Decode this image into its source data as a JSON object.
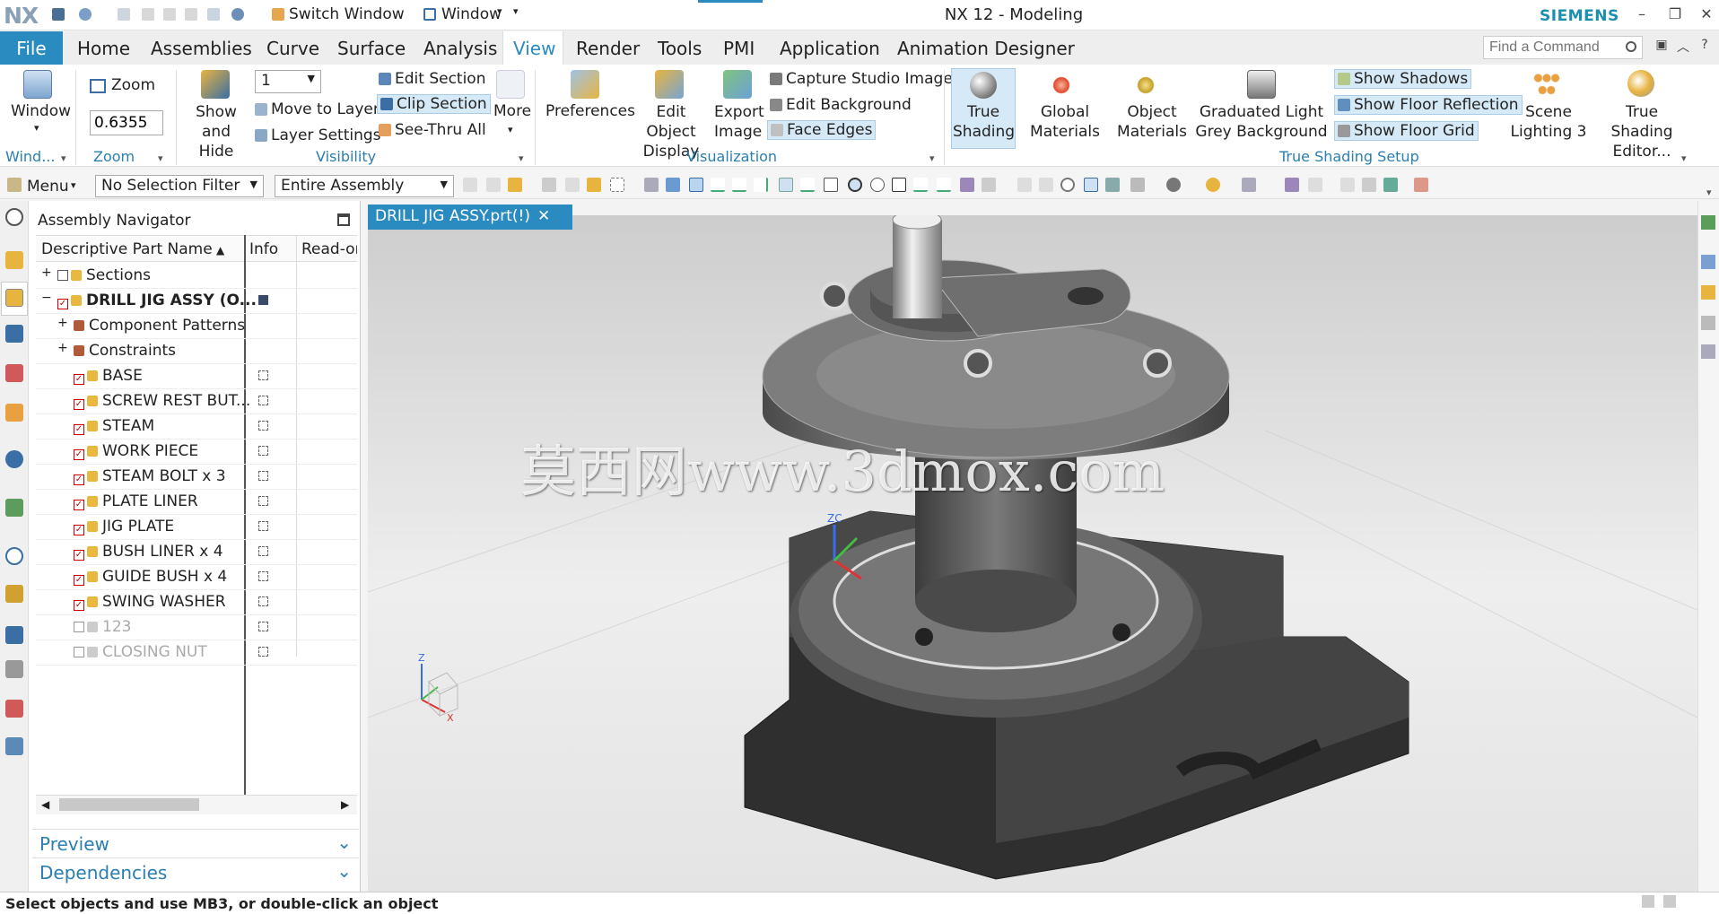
{
  "titlebar": {
    "logo": "NX",
    "switch_window": "Switch Window",
    "window_menu": "Window",
    "title": "NX 12 - Modeling",
    "brand": "SIEMENS"
  },
  "menubar": {
    "file": "File",
    "tabs": [
      "Home",
      "Assemblies",
      "Curve",
      "Surface",
      "Analysis",
      "View",
      "Render",
      "Tools",
      "PMI",
      "Application",
      "Animation Designer"
    ],
    "active_tab": "View",
    "find_placeholder": "Find a Command"
  },
  "ribbon": {
    "window": {
      "label": "Window",
      "group": "Wind..."
    },
    "zoom": {
      "label": "Zoom",
      "value": "0.6355",
      "group": "Zoom"
    },
    "visibility": {
      "show_hide": "Show and Hide",
      "layer_value": "1",
      "move_to_layer": "Move to Layer",
      "layer_settings": "Layer Settings",
      "edit_section": "Edit Section",
      "clip_section": "Clip Section",
      "see_thru": "See-Thru All",
      "more": "More",
      "group": "Visibility"
    },
    "visualization": {
      "preferences": "Preferences",
      "edit_object_display": "Edit Object Display",
      "export_image": "Export Image",
      "capture_studio": "Capture Studio Image",
      "edit_background": "Edit Background",
      "face_edges": "Face Edges",
      "group": "Visualization"
    },
    "true_shading": {
      "true_shading": "True Shading",
      "global_materials": "Global Materials",
      "object_materials": "Object Materials",
      "graduated_light": "Graduated Light Grey Background",
      "show_shadows": "Show Shadows",
      "show_floor_reflection": "Show Floor Reflection",
      "show_floor_grid": "Show Floor Grid",
      "scene_lighting": "Scene Lighting 3",
      "true_shading_editor": "True Shading Editor...",
      "group": "True Shading Setup"
    }
  },
  "toolbar": {
    "menu": "Menu",
    "selection_filter": "No Selection Filter",
    "scope": "Entire Assembly"
  },
  "navigator": {
    "title": "Assembly Navigator",
    "columns": [
      "Descriptive Part Name",
      "Info",
      "Read-or"
    ],
    "rows": [
      {
        "name": "Sections",
        "indent": 0,
        "type": "folder"
      },
      {
        "name": "DRILL JIG ASSY (O...",
        "indent": 0,
        "type": "assy",
        "bold": true
      },
      {
        "name": "Component Patterns",
        "indent": 1,
        "type": "folder"
      },
      {
        "name": "Constraints",
        "indent": 1,
        "type": "folder"
      },
      {
        "name": "BASE",
        "indent": 1,
        "type": "part"
      },
      {
        "name": "SCREW REST BUT...",
        "indent": 1,
        "type": "part"
      },
      {
        "name": "STEAM",
        "indent": 1,
        "type": "part"
      },
      {
        "name": "WORK PIECE",
        "indent": 1,
        "type": "part"
      },
      {
        "name": "STEAM BOLT x 3",
        "indent": 1,
        "type": "part"
      },
      {
        "name": "PLATE LINER",
        "indent": 1,
        "type": "part"
      },
      {
        "name": "JIG PLATE",
        "indent": 1,
        "type": "part"
      },
      {
        "name": "BUSH LINER x 4",
        "indent": 1,
        "type": "part"
      },
      {
        "name": "GUIDE BUSH x 4",
        "indent": 1,
        "type": "part"
      },
      {
        "name": "SWING WASHER",
        "indent": 1,
        "type": "part"
      },
      {
        "name": "123",
        "indent": 1,
        "type": "part",
        "dim": true
      },
      {
        "name": "CLOSING NUT",
        "indent": 1,
        "type": "part",
        "dim": true
      }
    ],
    "preview": "Preview",
    "dependencies": "Dependencies"
  },
  "viewport": {
    "tab": "DRILL JIG ASSY.prt(!)",
    "watermark": "莫西网www.3dmox.com",
    "axis_z": "Z",
    "axis_x": "X",
    "axis_y": "Y",
    "model_axis": "ZC"
  },
  "status": {
    "message": "Select objects and use MB3, or double-click an object"
  },
  "colors": {
    "accent": "#2a8bc0",
    "group_title": "#2a7fb0",
    "highlight": "#d6e9f6",
    "model": "#5a5a5a"
  }
}
